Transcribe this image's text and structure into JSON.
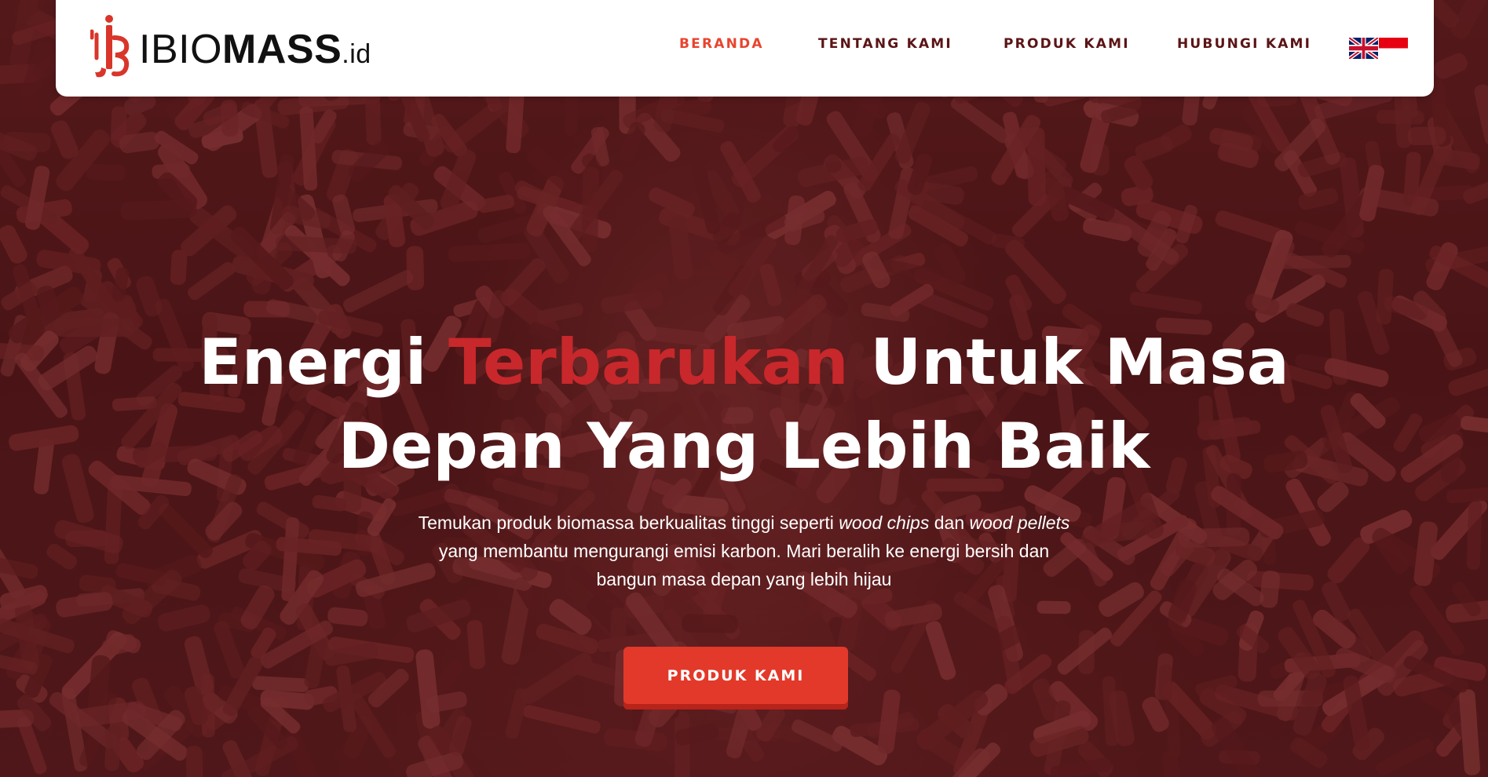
{
  "brand": {
    "prefix": "IBIO",
    "name": "MASS",
    "tld": ".id",
    "accent_color": "#e2392a"
  },
  "nav": {
    "items": [
      {
        "label": "BERANDA",
        "active": true
      },
      {
        "label": "TENTANG KAMI",
        "active": false
      },
      {
        "label": "PRODUK KAMI",
        "active": false
      },
      {
        "label": "HUBUNGI KAMI",
        "active": false
      }
    ],
    "languages": [
      {
        "icon": "uk-flag-icon"
      },
      {
        "icon": "indonesia-flag-icon"
      }
    ]
  },
  "hero": {
    "headline": {
      "part1": "Energi ",
      "highlight": "Terbarukan",
      "part2": " Untuk Masa",
      "line2": "Depan Yang Lebih Baik"
    },
    "description": {
      "before": "Temukan produk biomassa berkualitas tinggi seperti ",
      "term1": "wood chips",
      "middle": " dan ",
      "term2": "wood pellets",
      "line2": "yang membantu mengurangi emisi karbon. Mari beralih ke energi bersih dan",
      "line3": "bangun masa depan yang lebih hijau"
    },
    "cta_label": "PRODUK KAMI",
    "highlight_color": "#c8282b",
    "background_icon": "wood-pellets-background"
  }
}
